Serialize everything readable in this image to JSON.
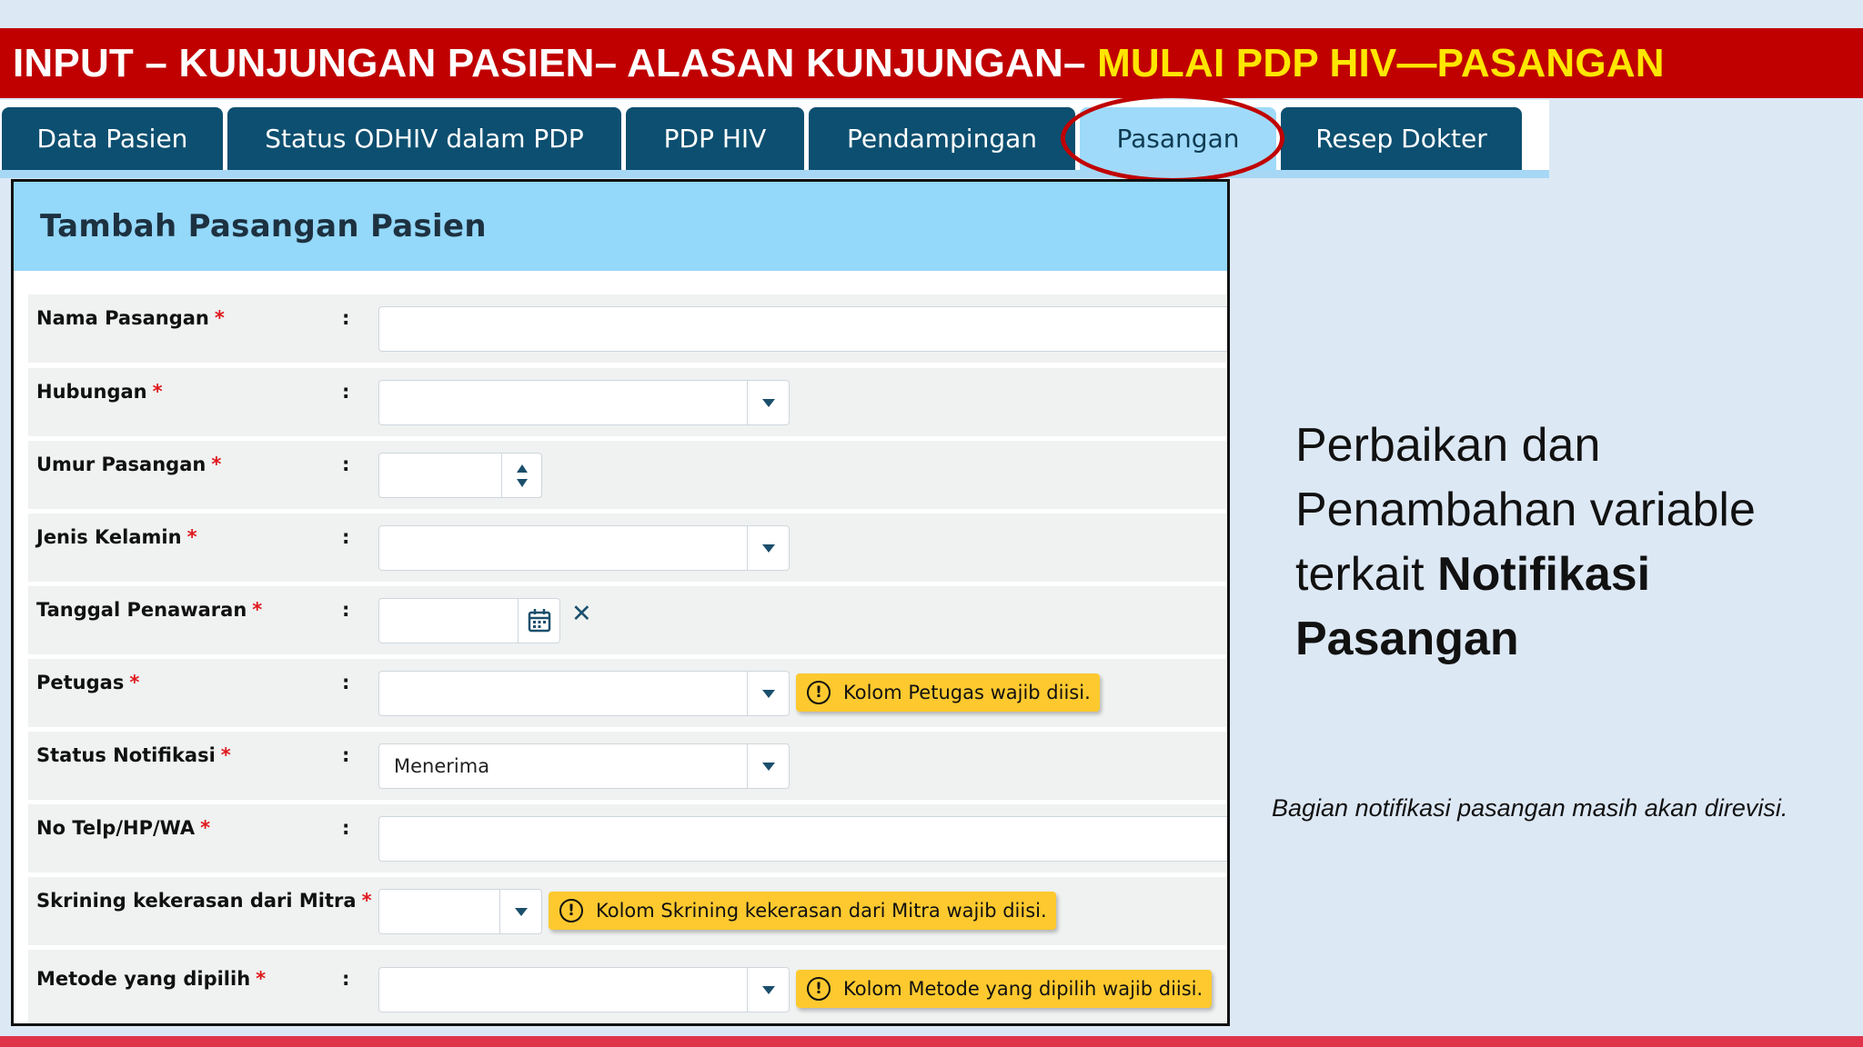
{
  "slide": {
    "title_main": "INPUT – KUNJUNGAN PASIEN– ALASAN KUNJUNGAN– ",
    "title_highlight": "MULAI PDP HIV—PASANGAN",
    "side_text_plain": "Perbaikan dan Penambahan variable terkait ",
    "side_text_bold": "Notifikasi Pasangan",
    "note": "Bagian notifikasi pasangan masih akan direvisi."
  },
  "tabs": [
    {
      "label": "Data Pasien",
      "active": false
    },
    {
      "label": "Status ODHIV dalam PDP",
      "active": false
    },
    {
      "label": "PDP HIV",
      "active": false
    },
    {
      "label": "Pendampingan",
      "active": false
    },
    {
      "label": "Pasangan",
      "active": true
    },
    {
      "label": "Resep Dokter",
      "active": false
    }
  ],
  "form": {
    "title": "Tambah Pasangan Pasien",
    "required_mark": "*",
    "colon": ":",
    "fields": {
      "nama_pasangan": {
        "label": "Nama Pasangan",
        "value": ""
      },
      "hubungan": {
        "label": "Hubungan",
        "value": ""
      },
      "umur_pasangan": {
        "label": "Umur Pasangan",
        "value": ""
      },
      "jenis_kelamin": {
        "label": "Jenis Kelamin",
        "value": ""
      },
      "tanggal_penawaran": {
        "label": "Tanggal Penawaran",
        "value": "",
        "clear_icon": "✕"
      },
      "petugas": {
        "label": "Petugas",
        "value": "",
        "warning": "Kolom Petugas wajib diisi."
      },
      "status_notifikasi": {
        "label": "Status Notifikasi",
        "value": "Menerima"
      },
      "no_telp": {
        "label": "No Telp/HP/WA",
        "value": ""
      },
      "skrining": {
        "label": "Skrining kekerasan dari Mitra",
        "value": "",
        "warning": "Kolom Skrining kekerasan dari Mitra wajib diisi."
      },
      "metode": {
        "label": "Metode yang dipilih",
        "value": "",
        "warning": "Kolom Metode yang dipilih wajib diisi."
      }
    }
  },
  "colors": {
    "title_bar": "#c00000",
    "title_highlight": "#ffe600",
    "tab": "#0d4f70",
    "tab_active": "#9fdafa",
    "panel_header": "#94d8fa",
    "warning": "#fdc92f",
    "required": "#e0191d"
  },
  "icons": {
    "dropdown": "chevron-down-icon",
    "spinner": "spinner-arrows-icon",
    "calendar": "calendar-icon",
    "clear": "close-icon",
    "warning": "exclamation-circle-icon"
  }
}
